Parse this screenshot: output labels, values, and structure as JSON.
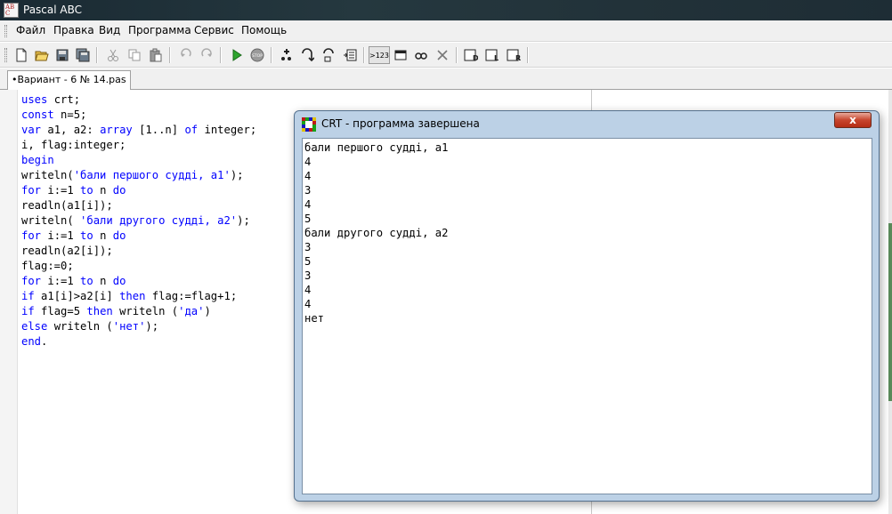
{
  "window": {
    "title": "Pascal ABC",
    "app_icon_letters": [
      "AB",
      "C"
    ]
  },
  "menu": {
    "items": [
      "Файл",
      "Правка",
      "Вид",
      "Программа",
      "Сервис",
      "Помощь"
    ]
  },
  "toolbar": {
    "buttons": [
      {
        "name": "new-file-icon"
      },
      {
        "name": "open-folder-icon"
      },
      {
        "name": "save-icon"
      },
      {
        "name": "save-all-icon"
      },
      {
        "name": "cut-icon"
      },
      {
        "name": "copy-icon"
      },
      {
        "name": "paste-icon"
      },
      {
        "name": "undo-icon"
      },
      {
        "name": "redo-icon"
      },
      {
        "name": "run-icon"
      },
      {
        "name": "stop-icon"
      },
      {
        "name": "step-into-icon"
      },
      {
        "name": "step-over-icon"
      },
      {
        "name": "step-out-icon"
      },
      {
        "name": "run-to-cursor-icon"
      },
      {
        "name": "output-format-icon"
      },
      {
        "name": "window-icon"
      },
      {
        "name": "watch-icon"
      },
      {
        "name": "clear-icon"
      },
      {
        "name": "tool-d-icon"
      },
      {
        "name": "tool-l-icon"
      },
      {
        "name": "tool-r-icon"
      }
    ],
    "stop_label": "STOP",
    "format_label": ">123",
    "tool_d_label": "D",
    "tool_l_label": "L",
    "tool_r_label": "R"
  },
  "tabs": [
    {
      "label": "•Вариант - 6 № 14.pas"
    }
  ],
  "editor": {
    "lines": [
      [
        {
          "t": "uses",
          "c": "kw"
        },
        {
          "t": " crt;"
        }
      ],
      [
        {
          "t": "const",
          "c": "kw"
        },
        {
          "t": " n=5;"
        }
      ],
      [
        {
          "t": "var",
          "c": "kw"
        },
        {
          "t": " a1, a2: "
        },
        {
          "t": "array",
          "c": "kw"
        },
        {
          "t": " [1..n] "
        },
        {
          "t": "of",
          "c": "kw"
        },
        {
          "t": " integer;"
        }
      ],
      [
        {
          "t": "i, flag:integer;"
        }
      ],
      [
        {
          "t": "begin",
          "c": "kw"
        }
      ],
      [
        {
          "t": "writeln("
        },
        {
          "t": "'бали першого судді, a1'",
          "c": "str"
        },
        {
          "t": ");"
        }
      ],
      [
        {
          "t": "for",
          "c": "kw"
        },
        {
          "t": " i:=1 "
        },
        {
          "t": "to",
          "c": "kw"
        },
        {
          "t": " n "
        },
        {
          "t": "do",
          "c": "kw"
        }
      ],
      [
        {
          "t": "readln(a1[i]);"
        }
      ],
      [
        {
          "t": "writeln( "
        },
        {
          "t": "'бали другого судді, a2'",
          "c": "str"
        },
        {
          "t": ");"
        }
      ],
      [
        {
          "t": "for",
          "c": "kw"
        },
        {
          "t": " i:=1 "
        },
        {
          "t": "to",
          "c": "kw"
        },
        {
          "t": " n "
        },
        {
          "t": "do",
          "c": "kw"
        }
      ],
      [
        {
          "t": "readln(a2[i]);"
        }
      ],
      [
        {
          "t": "flag:=0;"
        }
      ],
      [
        {
          "t": "for",
          "c": "kw"
        },
        {
          "t": " i:=1 "
        },
        {
          "t": "to",
          "c": "kw"
        },
        {
          "t": " n "
        },
        {
          "t": "do",
          "c": "kw"
        }
      ],
      [
        {
          "t": "if",
          "c": "kw"
        },
        {
          "t": " a1[i]>a2[i] "
        },
        {
          "t": "then",
          "c": "kw"
        },
        {
          "t": " flag:=flag+1;"
        }
      ],
      [
        {
          "t": "if",
          "c": "kw"
        },
        {
          "t": " flag=5 "
        },
        {
          "t": "then",
          "c": "kw"
        },
        {
          "t": " writeln ("
        },
        {
          "t": "'да'",
          "c": "str"
        },
        {
          "t": ")"
        }
      ],
      [
        {
          "t": "else",
          "c": "kw"
        },
        {
          "t": " writeln ("
        },
        {
          "t": "'нет'",
          "c": "str"
        },
        {
          "t": ");"
        }
      ],
      [
        {
          "t": "end",
          "c": "kw"
        },
        {
          "t": "."
        }
      ]
    ],
    "keyword_color": "#0000ff"
  },
  "crt": {
    "title": "CRT - программа завершена",
    "close_label": "x",
    "output": [
      "бали першого судді, a1",
      "4",
      "4",
      "3",
      "4",
      "5",
      "бали другого судді, a2",
      "3",
      "5",
      "3",
      "4",
      "4",
      "нет"
    ]
  }
}
